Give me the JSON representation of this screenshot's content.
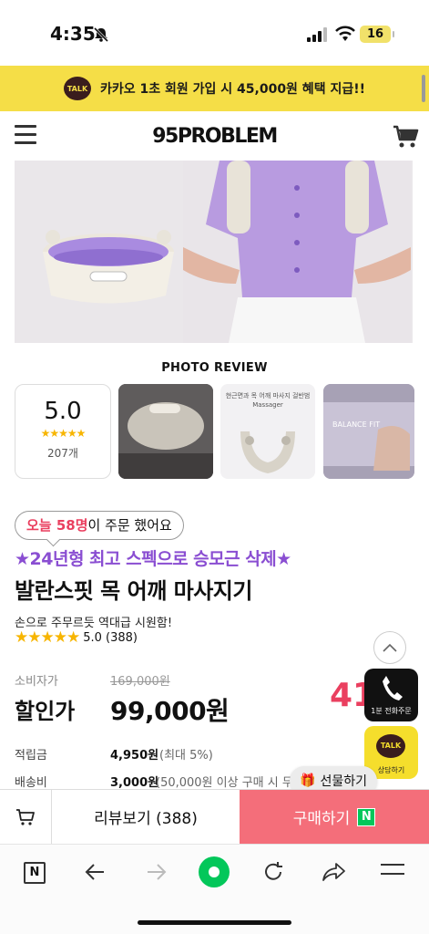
{
  "status_bar": {
    "time": "4:35",
    "battery": "16"
  },
  "promo": {
    "badge": "TALK",
    "text": "카카오 1초 회원 가입 시 45,000원 혜택 지급!!"
  },
  "header": {
    "logo": "95PROBLEM"
  },
  "photo_review": {
    "title": "PHOTO REVIEW",
    "score": "5.0",
    "stars": "★★★★★",
    "count": "207개",
    "thumb2_text": "현근면과 목 어깨 마사지 걸반범\nMassager",
    "thumb3_text": "BALANCE FIT"
  },
  "product": {
    "orders_prefix": "오늘 58명",
    "orders_suffix": "이 주문 했어요",
    "tagline": "★24년형 최고 스펙으로 승모근 삭제★",
    "name": "발란스핏 목 어깨 마사지기",
    "subtitle": "손으로 주무르듯 역대급 시원함!",
    "rating_stars": "★★★★★",
    "rating": "5.0 (388)"
  },
  "pricing": {
    "consumer_label": "소비자가",
    "original_price": "169,000원",
    "sale_label": "할인가",
    "sale_price": "99,000원",
    "discount": "41"
  },
  "details": {
    "points_label": "적립금",
    "points_value": "4,950원",
    "points_note": "(최대 5%)",
    "shipping_label": "배송비",
    "shipping_value": "3,000원",
    "shipping_note": "(50,000원 이상 구매 시 무"
  },
  "floating": {
    "call_label": "1분 전화주문",
    "kakao_badge": "TALK",
    "kakao_label": "상담하기",
    "gift_label": "선물하기"
  },
  "buybar": {
    "review_label": "리뷰보기 (388)",
    "buy_label": "구매하기",
    "npay": "N"
  },
  "browser": {
    "n_label": "N"
  },
  "colors": {
    "promo_bg": "#f5de47",
    "accent_pink": "#ea3f5f",
    "tagline_purple": "#8a4ed2",
    "buy_bg": "#f46e7a",
    "naver_green": "#03c75a"
  }
}
